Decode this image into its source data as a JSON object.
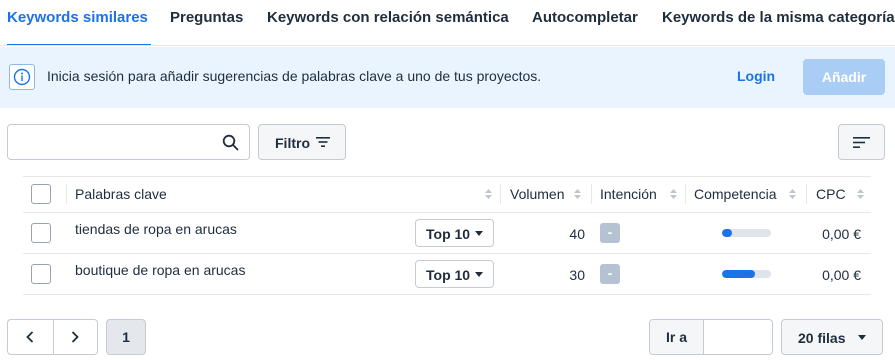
{
  "tabs": [
    {
      "label": "Keywords similares",
      "active": true
    },
    {
      "label": "Preguntas",
      "active": false
    },
    {
      "label": "Keywords con relación semántica",
      "active": false
    },
    {
      "label": "Autocompletar",
      "active": false
    },
    {
      "label": "Keywords de la misma categoría",
      "active": false
    }
  ],
  "banner": {
    "icon": "info-icon",
    "text": "Inicia sesión para añadir sugerencias de palabras clave a uno de tus proyectos.",
    "login_label": "Login",
    "add_label": "Añadir"
  },
  "toolbar": {
    "search_value": "",
    "search_placeholder": "",
    "filter_label": "Filtro"
  },
  "table": {
    "headers": {
      "keyword": "Palabras clave",
      "volume": "Volumen",
      "intent": "Intención",
      "competition": "Competencia",
      "cpc": "CPC"
    },
    "rows": [
      {
        "keyword": "tiendas de ropa en arucas",
        "top": "Top 10",
        "volume": "40",
        "intent": "-",
        "competition": 0.2,
        "cpc": "0,00 €"
      },
      {
        "keyword": "boutique de ropa en arucas",
        "top": "Top 10",
        "volume": "30",
        "intent": "-",
        "competition": 0.68,
        "cpc": "0,00 €"
      }
    ]
  },
  "pagination": {
    "current_page": "1",
    "goto_label": "Ir a",
    "goto_value": "",
    "rows_label": "20 filas"
  },
  "colors": {
    "accent": "#1a73e8",
    "banner_bg": "#eaf4fe",
    "add_button_disabled": "#a9cdf5",
    "intent_badge": "#b4c2d1"
  }
}
